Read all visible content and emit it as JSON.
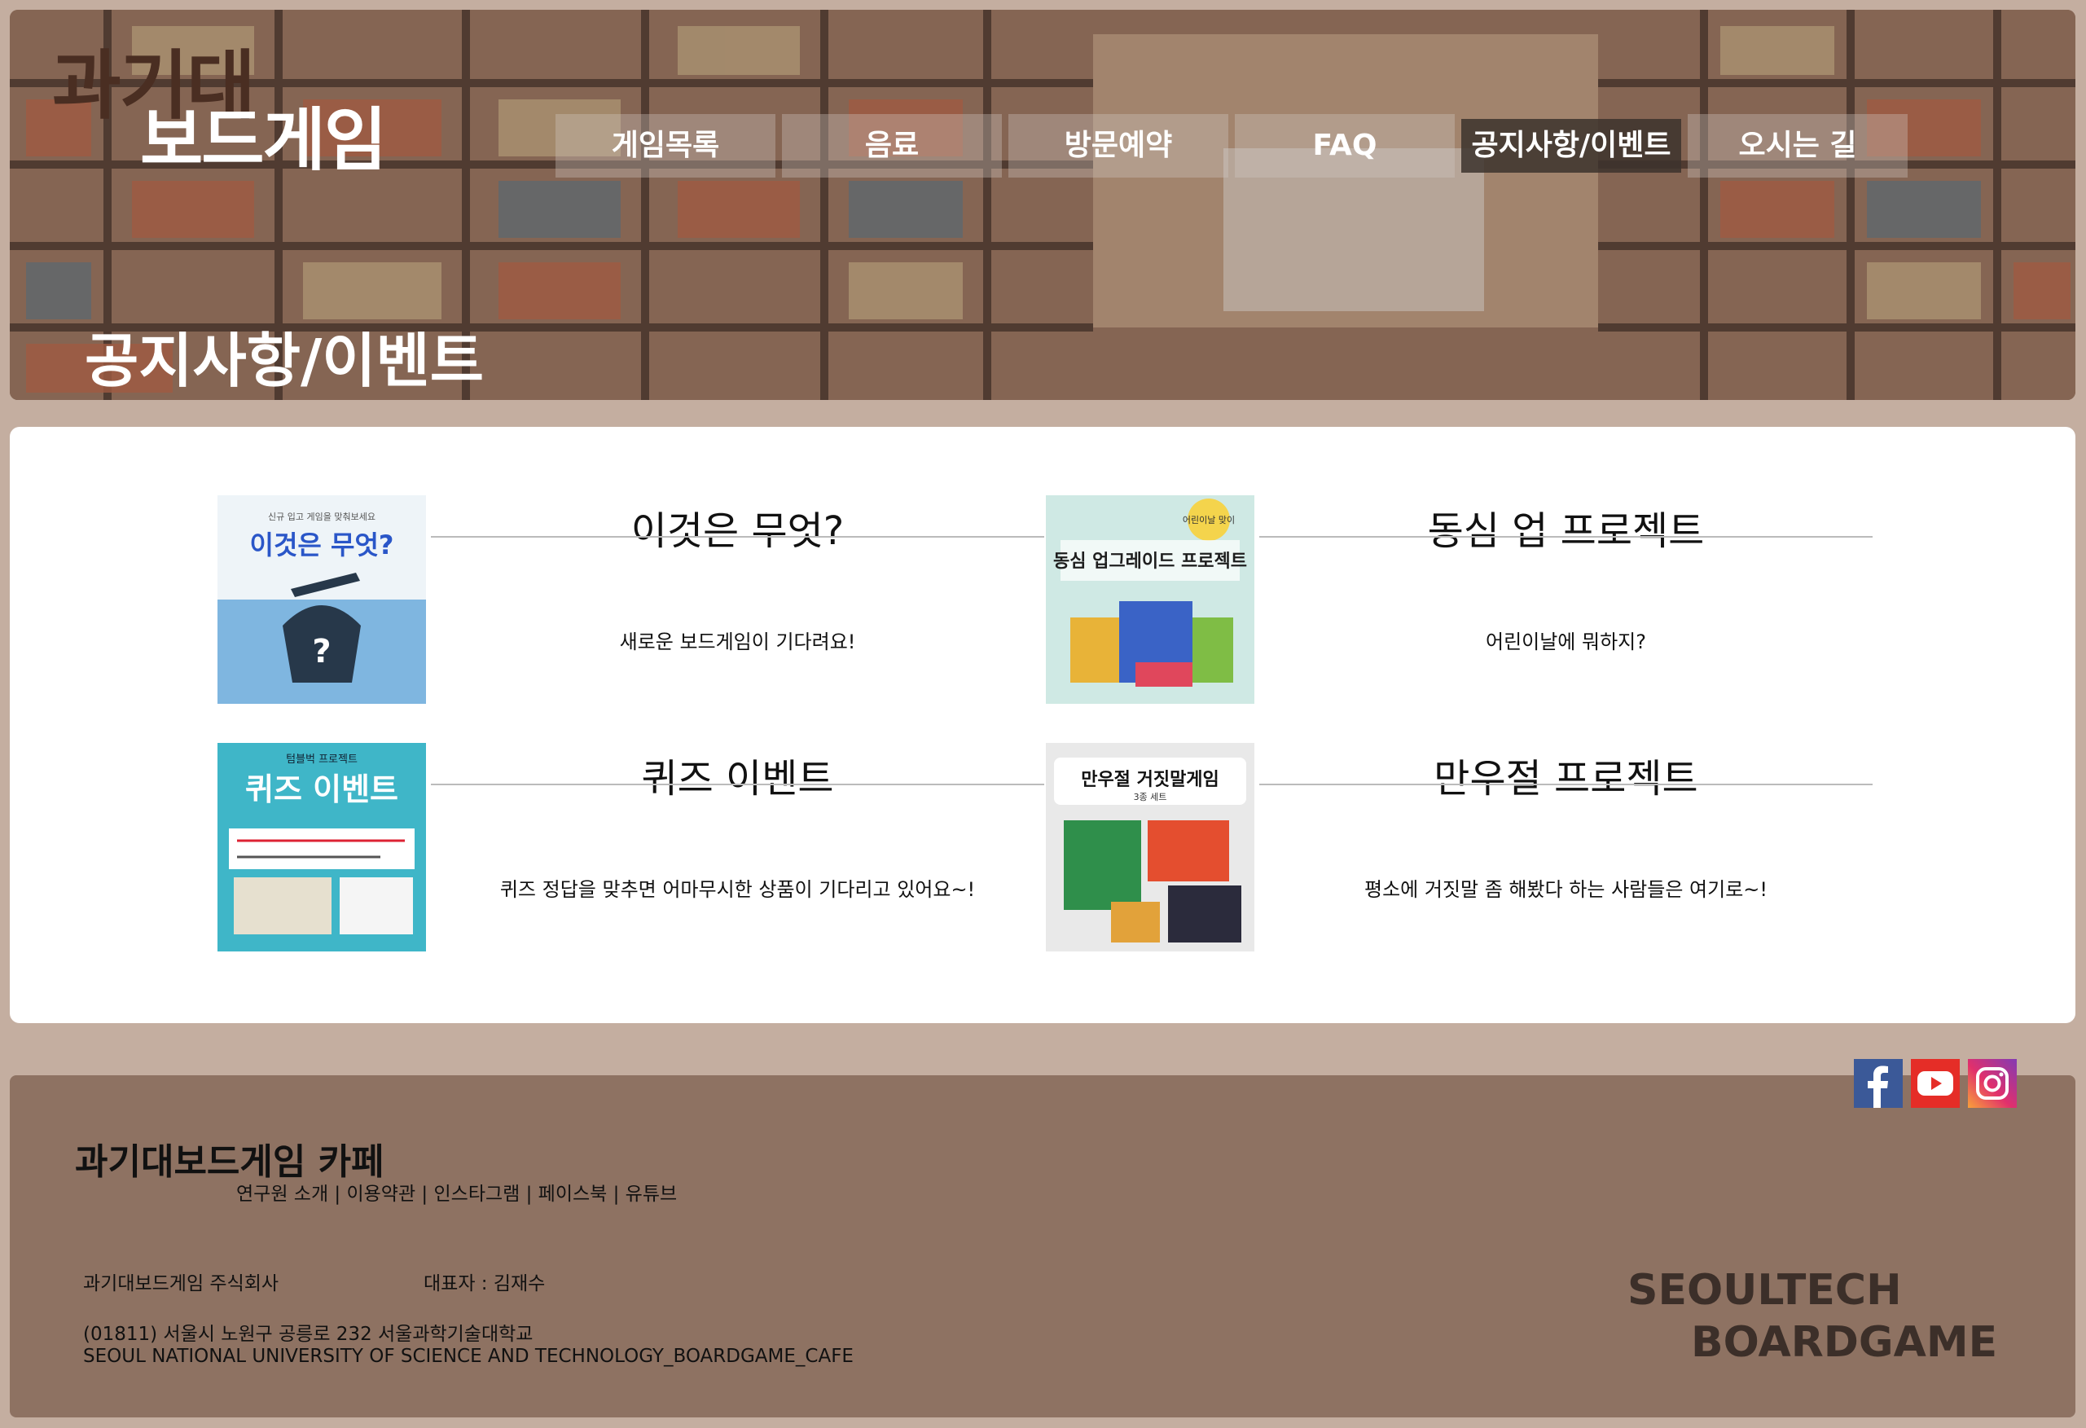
{
  "colors": {
    "page_bg": "#c4aea0",
    "footer_bg": "#8e7262",
    "hero_overlay": "#7b5c48"
  },
  "logo": {
    "line1": "과기대",
    "line2": "보드게임"
  },
  "nav": {
    "items": [
      {
        "label": "게임목록"
      },
      {
        "label": "음료"
      },
      {
        "label": "방문예약"
      },
      {
        "label": "FAQ"
      },
      {
        "label": "공지사항/이벤트",
        "active": true
      },
      {
        "label": "오시는 길"
      }
    ]
  },
  "hero": {
    "title": "공지사항/이벤트"
  },
  "cards": [
    {
      "title": "이것은 무엇?",
      "desc": "새로운 보드게임이 기다려요!",
      "thumb": {
        "caption": "이것은 무엇?",
        "sub": "신규 입고 게임을 맞춰보세요",
        "icon": "mystery-bag-icon"
      }
    },
    {
      "title": "동심 업 프로젝트",
      "desc": "어린이날에 뭐하지?",
      "thumb": {
        "caption": "동심 업그레이드 프로젝트",
        "badge": "어린이날 맞이",
        "icon": "boardgame-boxes-icon"
      }
    },
    {
      "title": "퀴즈 이벤트",
      "desc": "퀴즈 정답을 맞추면 어마무시한 상품이 기다리고 있어요~!",
      "thumb": {
        "caption": "퀴즈 이벤트",
        "top": "텀블벅 프로젝트",
        "icon": "quiz-board-icon"
      }
    },
    {
      "title": "만우절 프로젝트",
      "desc": "평소에 거짓말 좀 해봤다 하는 사람들은 여기로~!",
      "thumb": {
        "caption": "만우절 거짓말게임",
        "sub": "3종 세트",
        "icon": "bluff-games-icon"
      }
    }
  ],
  "social": [
    {
      "icon": "facebook-icon"
    },
    {
      "icon": "youtube-icon"
    },
    {
      "icon": "instagram-icon"
    }
  ],
  "footer": {
    "name": "과기대보드게임 카페",
    "links": "연구원 소개 | 이용약관 | 인스타그램 | 페이스북 | 유튜브",
    "company": "과기대보드게임 주식회사",
    "ceo": "대표자 : 김재수",
    "address": "(01811) 서울시 노원구 공릉로 232 서울과학기술대학교",
    "english": "SEOUL NATIONAL UNIVERSITY OF SCIENCE AND TECHNOLOGY_BOARDGAME_CAFE",
    "brand_line1": "SEOULTECH",
    "brand_line2": "BOARDGAME"
  }
}
